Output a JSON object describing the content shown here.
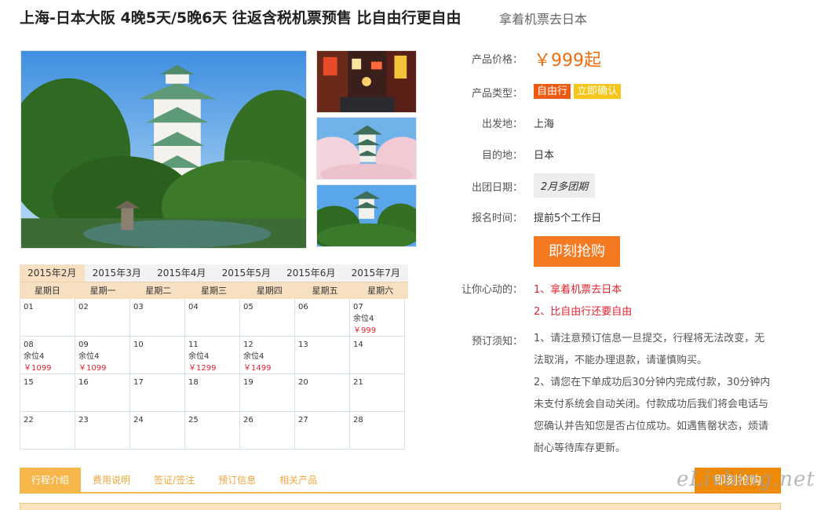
{
  "header": {
    "title": "上海-日本大阪 4晚5天/5晚6天 往返含税机票预售 比自由行更自由",
    "subtitle": "拿着机票去日本"
  },
  "calendar": {
    "months": [
      "2015年2月",
      "2015年3月",
      "2015年4月",
      "2015年5月",
      "2015年6月",
      "2015年7月"
    ],
    "weekdays": [
      "星期日",
      "星期一",
      "星期二",
      "星期三",
      "星期四",
      "星期五",
      "星期六"
    ],
    "days": [
      {
        "d": "01"
      },
      {
        "d": "02"
      },
      {
        "d": "03"
      },
      {
        "d": "04"
      },
      {
        "d": "05"
      },
      {
        "d": "06"
      },
      {
        "d": "07",
        "seats": "余位4",
        "price": "￥999"
      },
      {
        "d": "08",
        "seats": "余位4",
        "price": "￥1099"
      },
      {
        "d": "09",
        "seats": "余位4",
        "price": "￥1099"
      },
      {
        "d": "10"
      },
      {
        "d": "11",
        "seats": "余位4",
        "price": "￥1299"
      },
      {
        "d": "12",
        "seats": "余位4",
        "price": "￥1499"
      },
      {
        "d": "13"
      },
      {
        "d": "14"
      },
      {
        "d": "15"
      },
      {
        "d": "16"
      },
      {
        "d": "17"
      },
      {
        "d": "18"
      },
      {
        "d": "19"
      },
      {
        "d": "20"
      },
      {
        "d": "21"
      },
      {
        "d": "22"
      },
      {
        "d": "23"
      },
      {
        "d": "24"
      },
      {
        "d": "25"
      },
      {
        "d": "26"
      },
      {
        "d": "27"
      },
      {
        "d": "28"
      }
    ]
  },
  "info": {
    "price_label": "产品价格：",
    "price_value": "￥999起",
    "type_label": "产品类型：",
    "type_tags": [
      "自由行",
      "立即确认"
    ],
    "depart_label": "出发地：",
    "depart_value": "上海",
    "dest_label": "目的地：",
    "dest_value": "日本",
    "date_label": "出团日期：",
    "date_value": "2月多团期",
    "signup_label": "报名时间：",
    "signup_value": "提前5个工作日",
    "buy_button": "即刻抢购",
    "heart_label": "让你心动的：",
    "heart_items": [
      "1、拿着机票去日本",
      "2、比自由行还要自由"
    ],
    "notice_label": "预订须知：",
    "notice_items": [
      "1、请注意预订信息一旦提交，行程将无法改变，无法取消，不能办理退款，请谨慎购买。",
      "2、请您在下单成功后30分钟内完成付款，30分钟内未支付系统会自动关闭。付款成功后我们将会电话与您确认并告知您是否占位成功。如遇售罄状态，烦请耐心等待库存更新。"
    ]
  },
  "bottom_tabs": {
    "tabs": [
      "行程介绍",
      "费用说明",
      "签证/签注",
      "预订信息",
      "相关产品"
    ],
    "buy_button": "即刻抢购"
  },
  "watermark": "eLivbing.net",
  "colors": {
    "accent": "#f47a22",
    "price": "#ee6d10",
    "calendar_price": "#e0252f",
    "tab_bar": "#f7b64a"
  }
}
